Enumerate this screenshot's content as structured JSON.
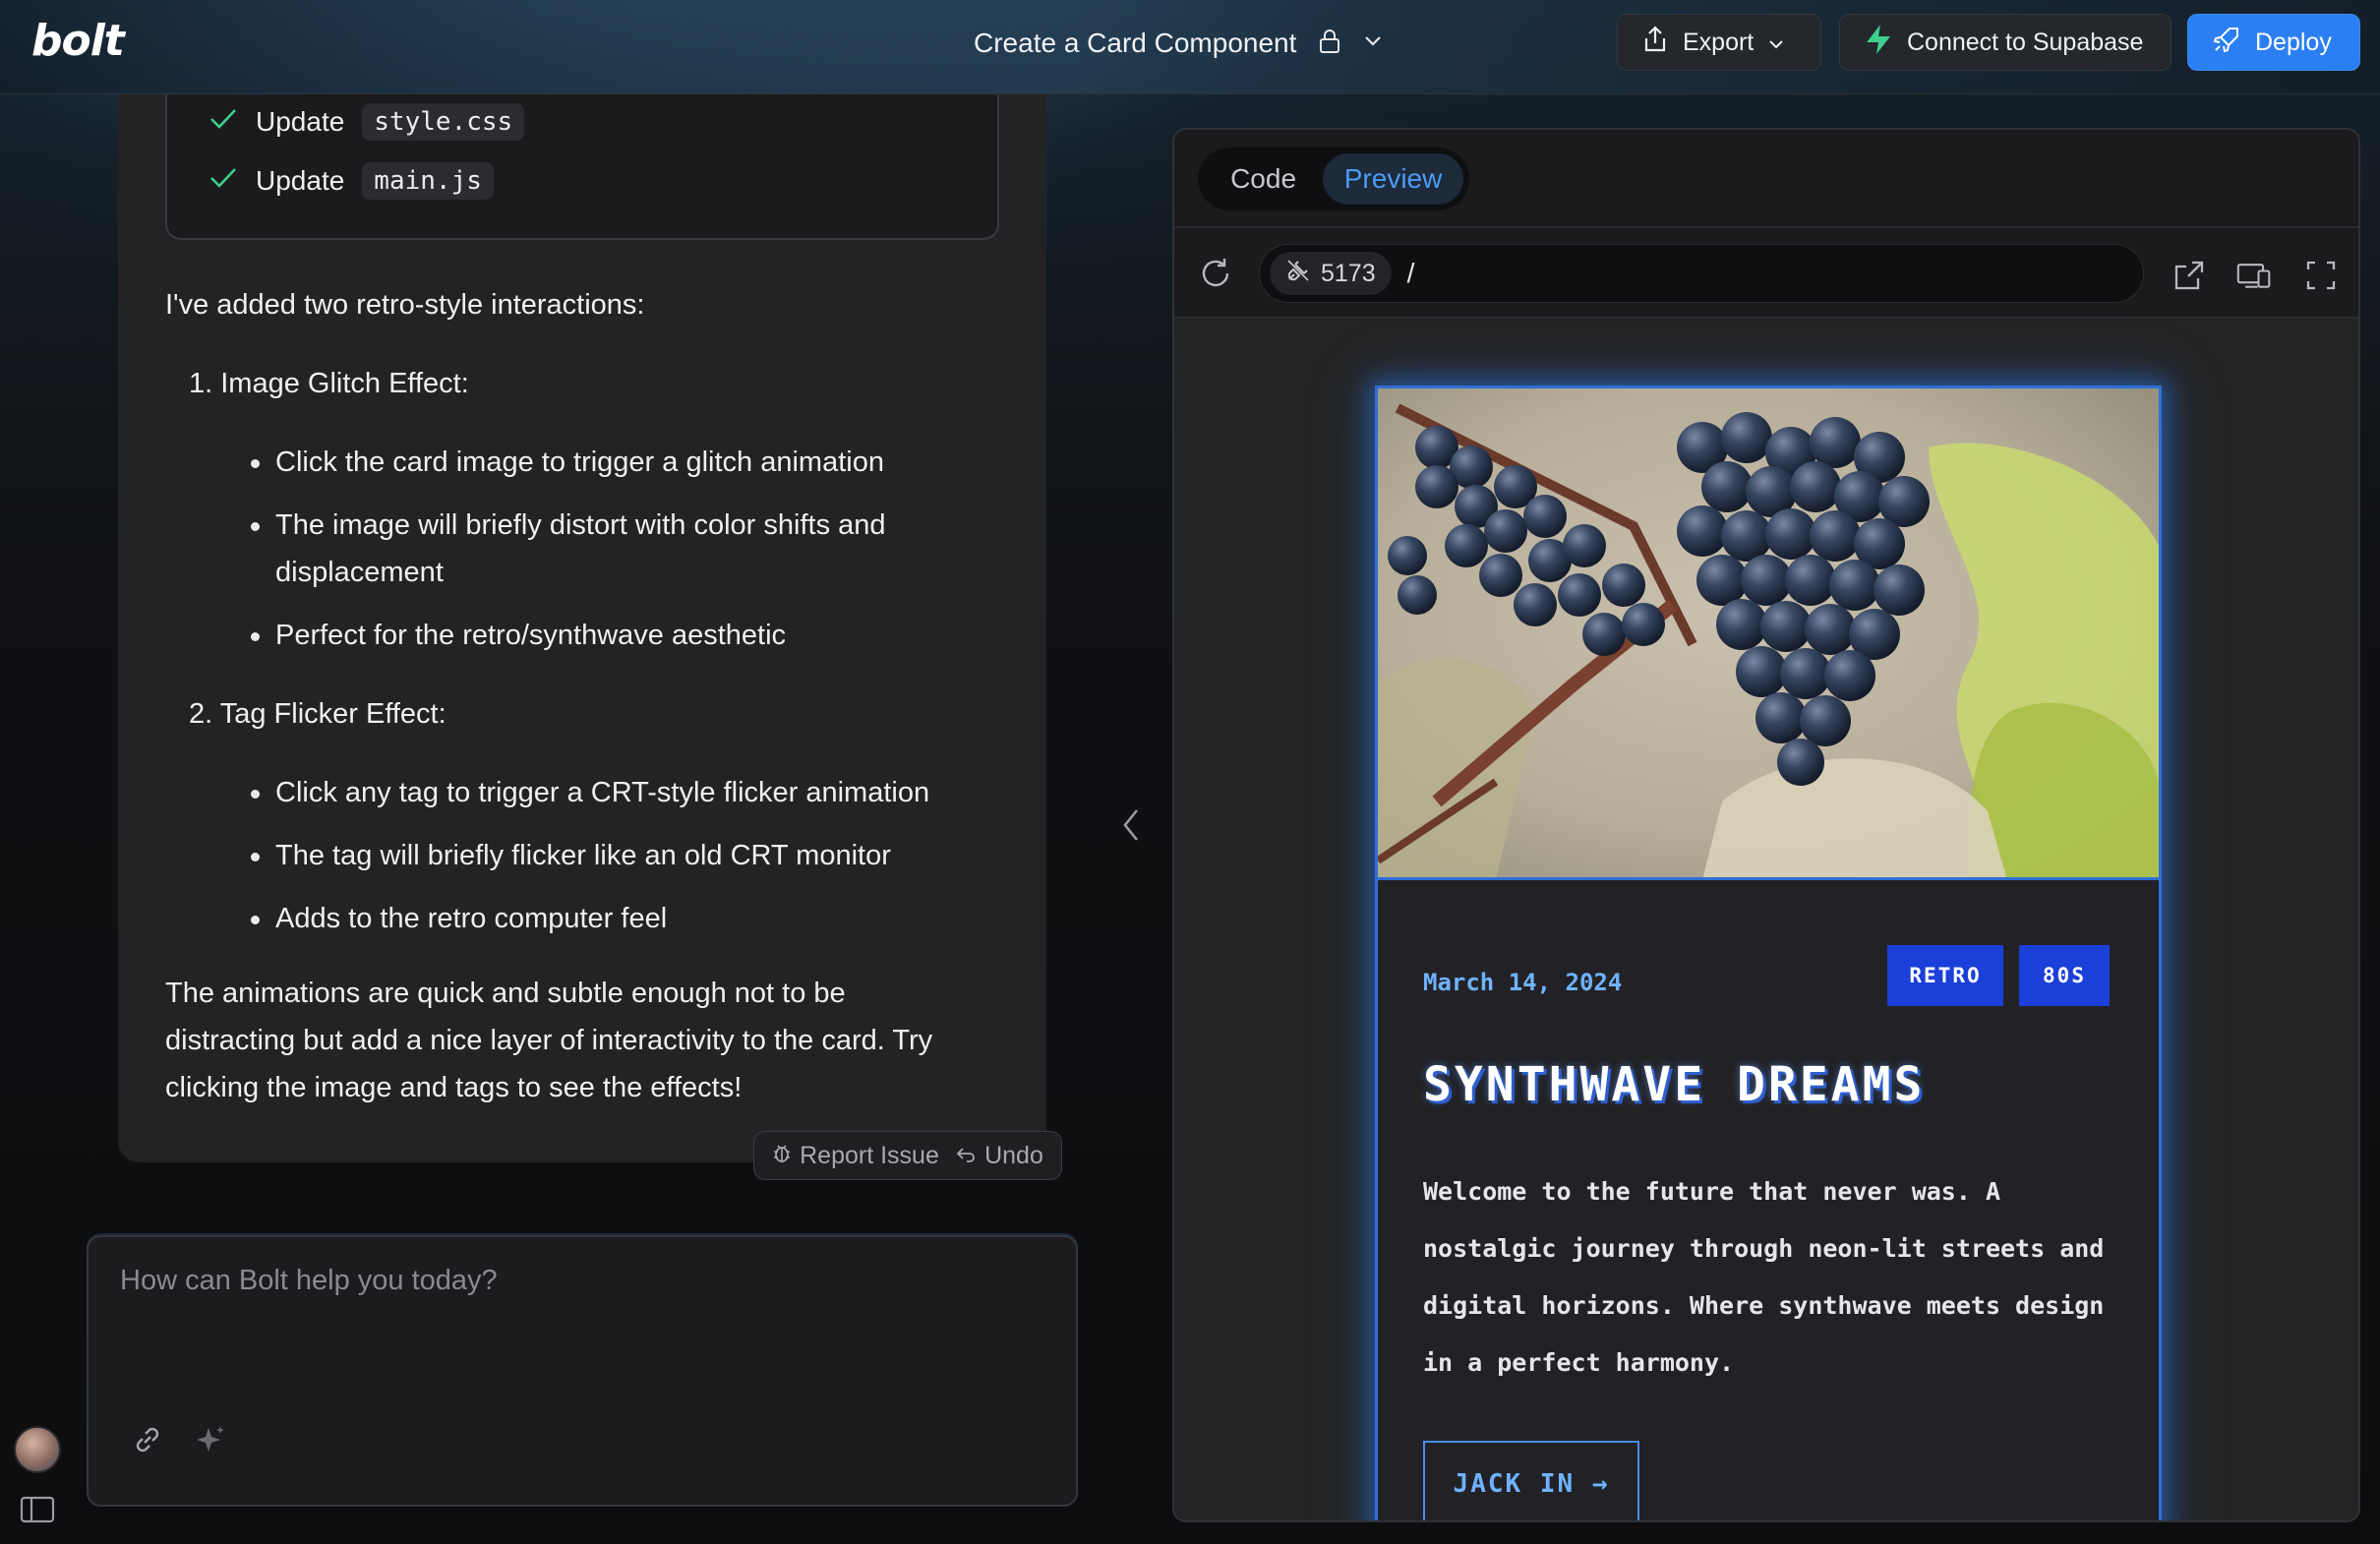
{
  "app": {
    "logo": "bolt"
  },
  "header": {
    "project_title": "Create a Card Component",
    "export_label": "Export",
    "supabase_label": "Connect to Supabase",
    "deploy_label": "Deploy"
  },
  "chat": {
    "file_updates": [
      {
        "verb": "Update",
        "file": "style.css"
      },
      {
        "verb": "Update",
        "file": "main.js"
      }
    ],
    "intro": "I've added two retro-style interactions:",
    "sections": [
      {
        "heading": "1. Image Glitch Effect:",
        "bullets": [
          "Click the card image to trigger a glitch animation",
          "The image will briefly distort with color shifts and displacement",
          "Perfect for the retro/synthwave aesthetic"
        ]
      },
      {
        "heading": "2. Tag Flicker Effect:",
        "bullets": [
          "Click any tag to trigger a CRT-style flicker animation",
          "The tag will briefly flicker like an old CRT monitor",
          "Adds to the retro computer feel"
        ]
      }
    ],
    "closing": "The animations are quick and subtle enough not to be distracting but add a nice layer of interactivity to the card. Try clicking the image and tags to see the effects!",
    "report_issue": "Report Issue",
    "undo": "Undo"
  },
  "prompt": {
    "placeholder": "How can Bolt help you today?"
  },
  "workbench": {
    "tabs": [
      "Code",
      "Preview"
    ],
    "active_tab": "Preview",
    "port": "5173",
    "path": "/"
  },
  "card": {
    "date": "March 14, 2024",
    "tags": [
      "RETRO",
      "80S"
    ],
    "title": "SYNTHWAVE DREAMS",
    "description": "Welcome to the future that never was. A nostalgic journey through neon-lit streets and digital horizons. Where synthwave meets design in a perfect harmony.",
    "button": "JACK IN →"
  },
  "colors": {
    "accent": "#2b7ff2",
    "card_border": "#2f6fd6",
    "tag_bg": "#1b3fd9",
    "supabase_green": "#3ecf8e"
  }
}
